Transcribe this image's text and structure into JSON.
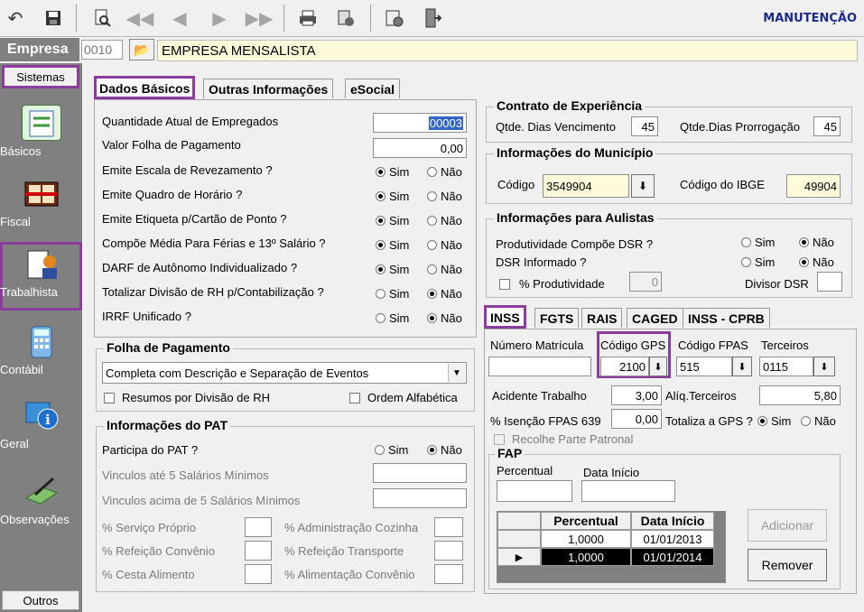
{
  "toolbar": {
    "buttons": [
      "undo-icon",
      "save-icon",
      "preview-icon",
      "first-icon",
      "prev-icon",
      "next-icon",
      "last-icon",
      "print-icon",
      "report-icon",
      "settings-icon",
      "exit-icon"
    ],
    "mode": "MANUTENÇÃO"
  },
  "empresa": {
    "label": "Empresa",
    "code": "0010",
    "name": "EMPRESA MENSALISTA"
  },
  "sidebar": {
    "head": "Sistemas",
    "items": [
      {
        "label": "Básicos",
        "icon": "notebook-icon"
      },
      {
        "label": "Fiscal",
        "icon": "book-icon"
      },
      {
        "label": "Trabalhista",
        "icon": "worker-icon"
      },
      {
        "label": "Contábil",
        "icon": "calculator-icon"
      },
      {
        "label": "Geral",
        "icon": "info-icon"
      },
      {
        "label": "Observações",
        "icon": "pen-icon"
      }
    ],
    "footer": "Outros"
  },
  "tabs": [
    "Dados Básicos",
    "Outras Informações",
    "eSocial"
  ],
  "basic": {
    "qtd_label": "Quantidade Atual de Empregados",
    "qtd_value": "00003",
    "folha_label": "Valor Folha de Pagamento",
    "folha_value": "0,00",
    "yes": "Sim",
    "no": "Não",
    "questions": [
      {
        "label": "Emite Escala de Revezamento ?",
        "value": "Sim"
      },
      {
        "label": "Emite Quadro de Horário ?",
        "value": "Sim"
      },
      {
        "label": "Emite Etiqueta p/Cartão de Ponto ?",
        "value": "Sim"
      },
      {
        "label": "Compõe Média Para Férias e 13º Salário ?",
        "value": "Sim"
      },
      {
        "label": "DARF de Autônomo Individualizado ?",
        "value": "Sim"
      },
      {
        "label": "Totalizar Divisão de RH p/Contabilização ?",
        "value": "Não"
      },
      {
        "label": "IRRF Unificado ?",
        "value": "Não"
      }
    ]
  },
  "folha": {
    "title": "Folha de Pagamento",
    "select": "Completa com Descrição e Separação de Eventos",
    "resumos": "Resumos por Divisão de RH",
    "ordem": "Ordem Alfabética"
  },
  "pat": {
    "title": "Informações do PAT",
    "participa": "Participa do PAT ?",
    "value": "Não",
    "vinc_ate": "Vinculos até 5 Salários Mínimos",
    "vinc_acima": "Vinculos acima de 5 Salários Mínimos",
    "servico": "% Serviço Próprio",
    "refeicao": "% Refeição Convênio",
    "cesta": "% Cesta Alimento",
    "adm": "% Administração Cozinha",
    "ref_transp": "% Refeição Transporte",
    "alimentacao": "% Alimentação Convênio"
  },
  "contrato": {
    "title": "Contrato de Experiência",
    "venc_label": "Qtde. Dias Vencimento",
    "venc_value": "45",
    "prorr_label": "Qtde.Dias Prorrogação",
    "prorr_value": "45"
  },
  "municipio": {
    "title": "Informações do Município",
    "codigo_label": "Código",
    "codigo_value": "3549904",
    "ibge_label": "Código do IBGE",
    "ibge_value": "49904"
  },
  "aulistas": {
    "title": "Informações para Aulistas",
    "prod_label": "Produtividade Compõe DSR ?",
    "prod_value": "Não",
    "dsr_label": "DSR Informado ?",
    "dsr_value": "Não",
    "perc_label": "% Produtividade",
    "perc_value": "0",
    "divisor_label": "Divisor DSR"
  },
  "subtabs": [
    "INSS",
    "FGTS",
    "RAIS",
    "CAGED",
    "INSS - CPRB"
  ],
  "inss": {
    "matricula_label": "Número Matrícula",
    "gps_label": "Código GPS",
    "gps_value": "2100",
    "fpas_label": "Código FPAS",
    "fpas_value": "515",
    "terceiros_label": "Terceiros",
    "terceiros_value": "0115",
    "acidente_label": "Acidente Trabalho",
    "acidente_value": "3,00",
    "aliq_label": "Alíq.Terceiros",
    "aliq_value": "5,80",
    "isencao_label": "% Isenção FPAS 639",
    "isencao_value": "0,00",
    "totaliza_label": "Totaliza a GPS ?",
    "totaliza_value": "Sim",
    "recolhe": "Recolhe Parte Patronal",
    "fap_title": "FAP",
    "fap_perc_label": "Percentual",
    "fap_data_label": "Data Início",
    "grid_headers": [
      "Percentual",
      "Data Início"
    ],
    "grid_rows": [
      [
        "1,0000",
        "01/01/2013"
      ],
      [
        "1,0000",
        "01/01/2014"
      ]
    ],
    "add": "Adicionar",
    "remove": "Remover"
  }
}
